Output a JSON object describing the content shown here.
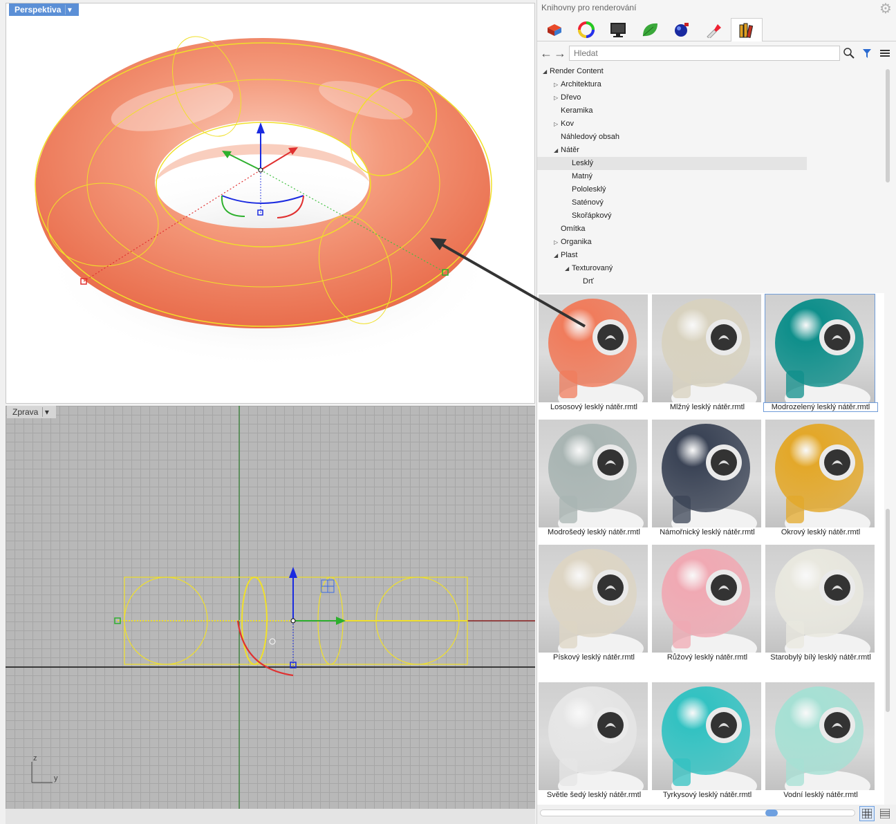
{
  "viewport_top": {
    "tab_label": "Perspektiva"
  },
  "viewport_bottom": {
    "tab_label": "Zprava",
    "axis_z": "z",
    "axis_y": "y"
  },
  "panel": {
    "title": "Knihovny pro renderování",
    "search_placeholder": "Hledat",
    "tree": [
      {
        "label": "Render Content",
        "level": 0,
        "state": "open"
      },
      {
        "label": "Architektura",
        "level": 1,
        "state": "closed"
      },
      {
        "label": "Dřevo",
        "level": 1,
        "state": "closed"
      },
      {
        "label": "Keramika",
        "level": 1,
        "state": "none"
      },
      {
        "label": "Kov",
        "level": 1,
        "state": "closed"
      },
      {
        "label": "Náhledový obsah",
        "level": 1,
        "state": "none"
      },
      {
        "label": "Nátěr",
        "level": 1,
        "state": "open"
      },
      {
        "label": "Lesklý",
        "level": 2,
        "state": "none",
        "selected": true
      },
      {
        "label": "Matný",
        "level": 2,
        "state": "none"
      },
      {
        "label": "Pololesklý",
        "level": 2,
        "state": "none"
      },
      {
        "label": "Saténový",
        "level": 2,
        "state": "none"
      },
      {
        "label": "Skořápkový",
        "level": 2,
        "state": "none"
      },
      {
        "label": "Omítka",
        "level": 1,
        "state": "none"
      },
      {
        "label": "Organika",
        "level": 1,
        "state": "closed"
      },
      {
        "label": "Plast",
        "level": 1,
        "state": "open"
      },
      {
        "label": "Texturovaný",
        "level": 2,
        "state": "open"
      },
      {
        "label": "Drť",
        "level": 3,
        "state": "none"
      }
    ],
    "materials": [
      {
        "label": "Lososový lesklý nátěr.rmtl",
        "color": "#f07c5c"
      },
      {
        "label": "Mlžný lesklý nátěr.rmtl",
        "color": "#d8d2bf"
      },
      {
        "label": "Modrozelený lesklý nátěr.rmtl",
        "color": "#0f8f8b",
        "selected": true
      },
      {
        "label": "Modrošedý lesklý nátěr.rmtl",
        "color": "#a9b5b3"
      },
      {
        "label": "Námořnický lesklý nátěr.rmtl",
        "color": "#3b4456"
      },
      {
        "label": "Okrový lesklý nátěr.rmtl",
        "color": "#e3a82a"
      },
      {
        "label": "Pískový lesklý nátěr.rmtl",
        "color": "#ddd5c4"
      },
      {
        "label": "Růžový lesklý nátěr.rmtl",
        "color": "#f0a9b3"
      },
      {
        "label": "Starobylý bílý lesklý nátěr.rmtl",
        "color": "#e9e8df"
      },
      {
        "label": "Světle šedý lesklý nátěr.rmtl",
        "color": "#e6e6e6"
      },
      {
        "label": "Tyrkysový lesklý nátěr.rmtl",
        "color": "#33c2c2"
      },
      {
        "label": "Vodní lesklý nátěr.rmtl",
        "color": "#a6e0d4"
      }
    ]
  }
}
